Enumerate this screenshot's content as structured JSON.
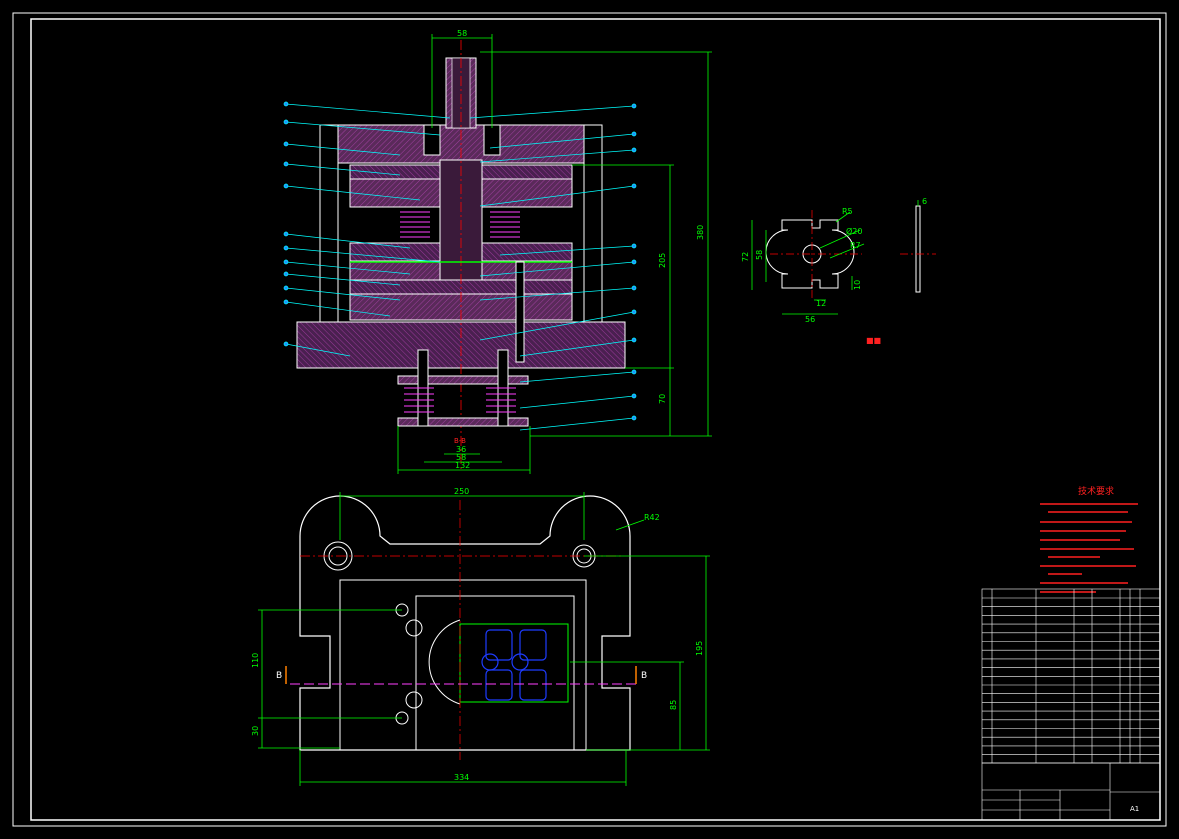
{
  "colors": {
    "background": "#000000",
    "frame": "#ffffff",
    "section_fill": "#5a2a5a",
    "hatch": "#b040b0",
    "dimension": "#00ff00",
    "leader": "#00ffff",
    "centerline": "#ff0000",
    "spring": "#ff40ff",
    "hidden": "#0000ff",
    "note_text": "#ff2020",
    "title_text": "#ffffff"
  },
  "front_view": {
    "dim_top_width": "58",
    "dim_total_height": "380",
    "dim_die_height": "205",
    "dim_lower_height": "70",
    "dim_bottom_36": "36",
    "dim_bottom_58": "58",
    "dim_bottom_132": "132",
    "section_label": "B-B"
  },
  "part_view": {
    "dim_72": "72",
    "dim_58": "58",
    "dim_56": "56",
    "dim_12": "12",
    "dim_10": "10",
    "dim_r5": "R5",
    "dim_phi20": "Ø20",
    "dim_r7": "R7",
    "dim_thickness": "6",
    "part_tag": "■■"
  },
  "plan_view": {
    "dim_width_top": "250",
    "dim_radius": "R42",
    "dim_left_110": "110",
    "dim_left_30": "30",
    "dim_right_195": "195",
    "dim_right_85": "85",
    "dim_width_bottom": "334",
    "section_mark_left": "B",
    "section_mark_right": "B"
  },
  "technical_requirements": {
    "title": "技术要求"
  },
  "title_block": {
    "sheet_label": "A1"
  }
}
